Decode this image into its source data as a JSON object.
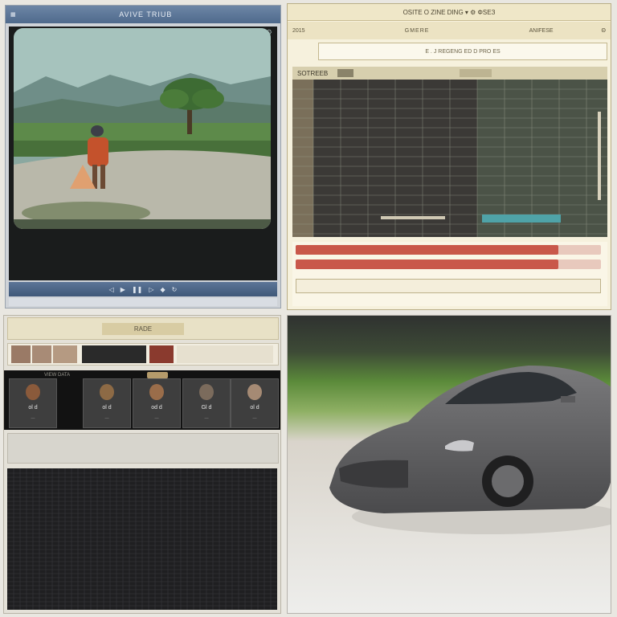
{
  "player": {
    "title": "AVIVE TRIUB",
    "controls": "ᴍᴍ ◁ ▷ ◁▷",
    "status": ""
  },
  "datagrid": {
    "menu": "OSITE O ZINE  DING ▾ ⚙ ΦSEЗ",
    "toolbar_left": "2015",
    "toolbar_mid": "GMERE",
    "toolbar_right": "ANIFESE",
    "toolbar_end": "Θ",
    "filter_text": "E . J   REGENG  ED  D   PRO   ES",
    "grid_header": "SOTREEB",
    "bars": [
      {
        "color": "#c9584a",
        "fill": 0.86
      },
      {
        "color": "#c9584a",
        "fill": 0.86
      }
    ]
  },
  "picker": {
    "tab_label": "RADE",
    "cards_title": "VIEW DATA",
    "cards": [
      {
        "label": "ol d",
        "sub": "—",
        "skin": "#8a5a3b"
      },
      {
        "label": "ol d",
        "sub": "—",
        "skin": "#8d6a45"
      },
      {
        "label": "od d",
        "sub": "—",
        "skin": "#9a6d4a"
      },
      {
        "label": "Gl d",
        "sub": "—",
        "skin": "#7b6b5c"
      },
      {
        "label": "ol d",
        "sub": "—",
        "skin": "#a58a74"
      }
    ]
  },
  "colors": {
    "player_titlebar": "#5a7496",
    "grid_accent": "#c9584a",
    "car_body": "#5a5a5c"
  }
}
